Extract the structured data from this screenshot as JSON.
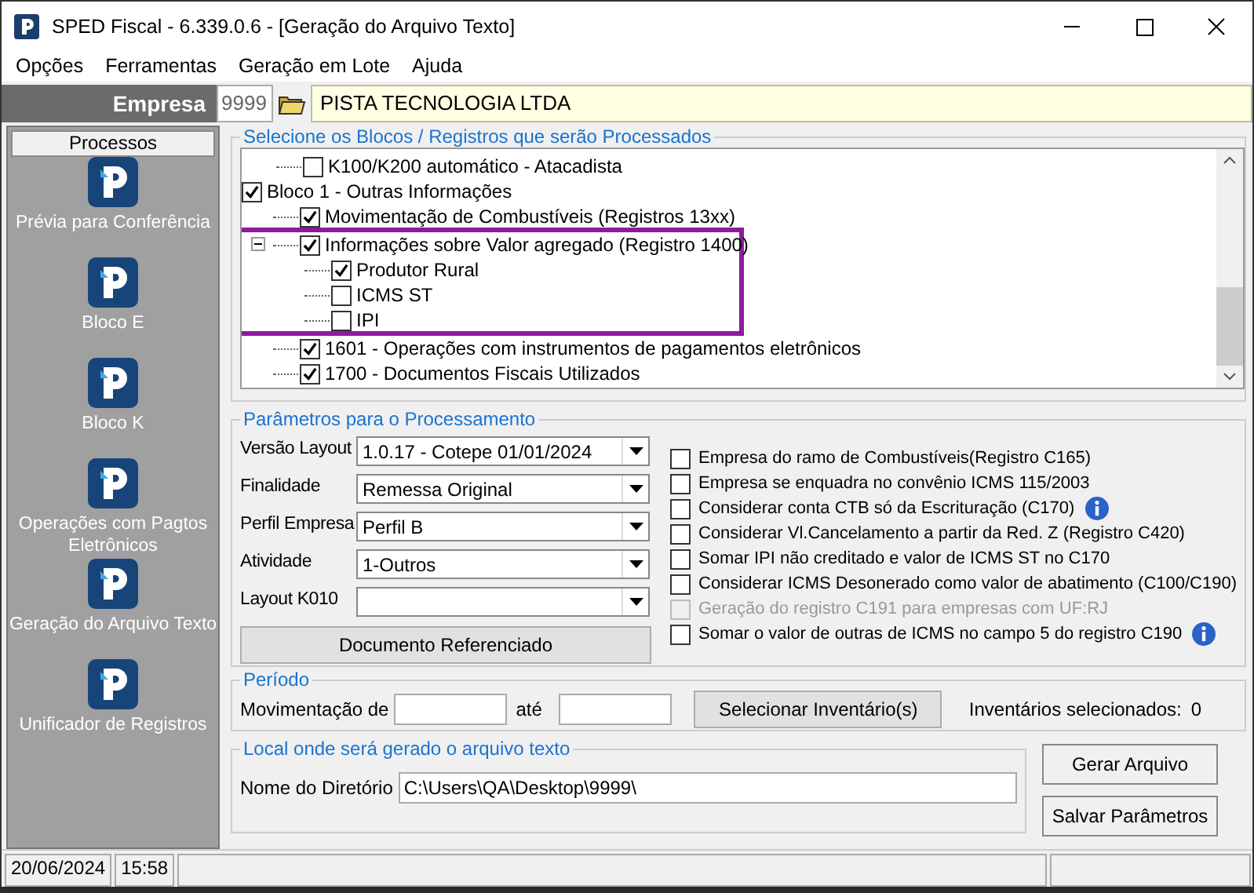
{
  "window": {
    "title": "SPED Fiscal - 6.339.0.6 - [Geração do Arquivo Texto]"
  },
  "menu": [
    "Opções",
    "Ferramentas",
    "Geração em Lote",
    "Ajuda"
  ],
  "empresa": {
    "label": "Empresa",
    "code": "9999",
    "name": "PISTA TECNOLOGIA LTDA"
  },
  "sidebar": {
    "title": "Processos",
    "items": [
      {
        "label": "Prévia para Conferência"
      },
      {
        "label": "Bloco E"
      },
      {
        "label": "Bloco K"
      },
      {
        "label": "Operações com Pagtos Eletrônicos"
      },
      {
        "label": "Geração do Arquivo Texto"
      },
      {
        "label": "Unificador de Registros"
      }
    ]
  },
  "blocks": {
    "title": "Selecione os Blocos / Registros que serão Processados",
    "tree": [
      {
        "children": [
          {
            "label": "K100/K200 automático - Atacadista",
            "checked": false
          }
        ]
      },
      {
        "label": "Bloco 1 - Outras Informações",
        "checked": true,
        "children": [
          {
            "label": "Movimentação de Combustíveis (Registros 13xx)",
            "checked": true
          },
          {
            "label": "Informações sobre Valor agregado (Registro 1400)",
            "checked": true,
            "expanded": true,
            "highlighted": true,
            "children": [
              {
                "label": "Produtor Rural",
                "checked": true
              },
              {
                "label": "ICMS ST",
                "checked": false
              },
              {
                "label": "IPI",
                "checked": false
              }
            ]
          },
          {
            "label": "1601 - Operações com instrumentos de pagamentos eletrônicos",
            "checked": true
          },
          {
            "label": "1700 - Documentos Fiscais Utilizados",
            "checked": true
          }
        ]
      }
    ]
  },
  "params": {
    "title": "Parâmetros para o Processamento",
    "fields": [
      {
        "label": "Versão Layout",
        "value": "1.0.17 - Cotepe 01/01/2024"
      },
      {
        "label": "Finalidade",
        "value": "Remessa Original"
      },
      {
        "label": "Perfil Empresa",
        "value": "Perfil B"
      },
      {
        "label": "Atividade",
        "value": "1-Outros"
      },
      {
        "label": "Layout K010"
      }
    ],
    "button": "Documento Referenciado",
    "options": [
      {
        "label": "Empresa do ramo de Combustíveis(Registro C165)",
        "checked": false,
        "disabled": false,
        "info": false
      },
      {
        "label": "Empresa se enquadra no convênio ICMS 115/2003",
        "checked": false,
        "disabled": false,
        "info": false
      },
      {
        "label": "Considerar conta CTB só da Escrituração (C170)",
        "checked": false,
        "disabled": false,
        "info": true
      },
      {
        "label": "Considerar Vl.Cancelamento a partir da Red. Z (Registro C420)",
        "checked": false,
        "disabled": false,
        "info": false
      },
      {
        "label": "Somar IPI não creditado e valor de ICMS ST no C170",
        "checked": false,
        "disabled": false,
        "info": false
      },
      {
        "label": "Considerar ICMS Desonerado como valor de abatimento (C100/C190)",
        "checked": false,
        "disabled": false,
        "info": false
      },
      {
        "label": "Geração do registro C191 para empresas com UF:RJ",
        "checked": false,
        "disabled": true,
        "info": false
      },
      {
        "label": "Somar o valor de outras de ICMS no campo 5 do registro C190",
        "checked": false,
        "disabled": false,
        "info": true
      }
    ]
  },
  "periodo": {
    "title": "Período",
    "from_label": "Movimentação de",
    "to_label": "até",
    "button": "Selecionar Inventário(s)",
    "count_label": "Inventários selecionados:",
    "count": "0"
  },
  "local": {
    "title": "Local onde será gerado o arquivo texto",
    "label": "Nome do Diretório",
    "value": "C:\\Users\\QA\\Desktop\\9999\\"
  },
  "buttons": [
    "Gerar Arquivo",
    "Salvar Parâmetros"
  ],
  "status_bar": [
    "20/06/2024",
    "15:58"
  ]
}
